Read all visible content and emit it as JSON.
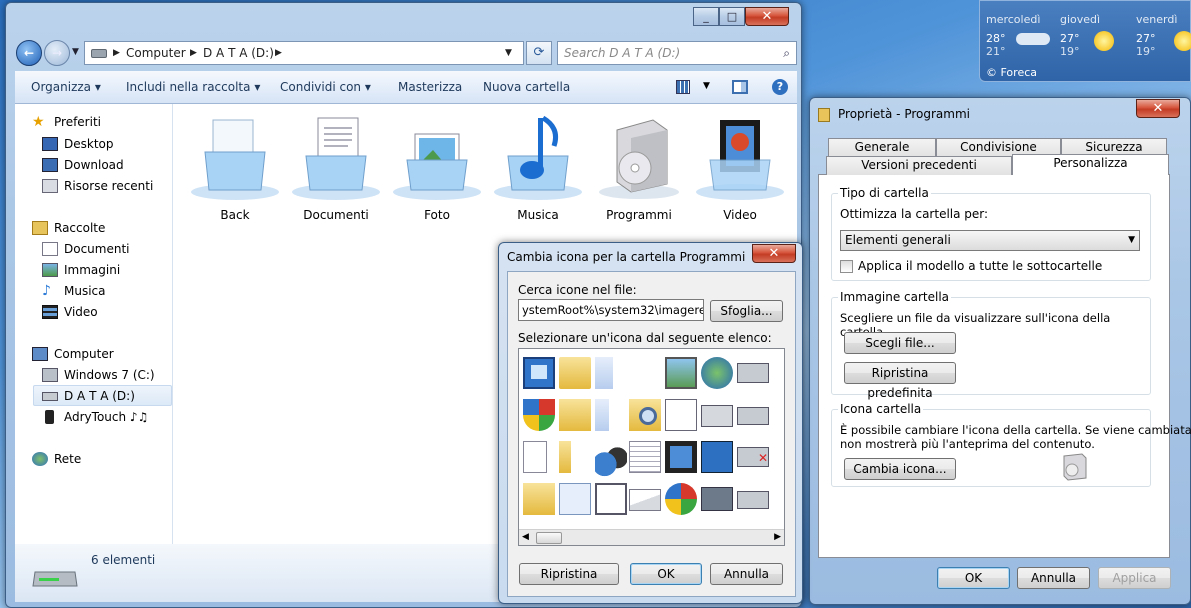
{
  "weather": {
    "days": [
      {
        "name": "mercoledì",
        "hi": "28°",
        "lo": "21°"
      },
      {
        "name": "giovedì",
        "hi": "27°",
        "lo": "19°"
      },
      {
        "name": "venerdì",
        "hi": "27°",
        "lo": "19°"
      }
    ],
    "provider": "© Foreca"
  },
  "explorer": {
    "breadcrumb": [
      "Computer",
      "D A T A (D:)"
    ],
    "search_placeholder": "Search D A T A (D:)",
    "toolbar": {
      "organize": "Organizza",
      "include": "Includi nella raccolta",
      "share": "Condividi con",
      "burn": "Masterizza",
      "new_folder": "Nuova cartella"
    },
    "nav": {
      "favorites": "Preferiti",
      "desktop": "Desktop",
      "downloads": "Download",
      "recent": "Risorse recenti",
      "libraries": "Raccolte",
      "documents": "Documenti",
      "pictures": "Immagini",
      "music": "Musica",
      "videos": "Video",
      "computer": "Computer",
      "drive_c": "Windows 7 (C:)",
      "drive_d": "D A T A (D:)",
      "device": "AdryTouch ♪♫",
      "network": "Rete"
    },
    "folders": [
      "Back",
      "Documenti",
      "Foto",
      "Musica",
      "Programmi",
      "Video"
    ],
    "status": "6 elementi"
  },
  "properties": {
    "title": "Proprietà - Programmi",
    "tabs_row1": [
      "Generale",
      "Condivisione",
      "Sicurezza"
    ],
    "tabs_row2": [
      "Versioni precedenti",
      "Personalizza"
    ],
    "folder_type": {
      "title": "Tipo di cartella",
      "optimize_label": "Ottimizza la cartella per:",
      "selected": "Elementi generali",
      "apply_sub": "Applica il modello a tutte le sottocartelle"
    },
    "folder_image": {
      "title": "Immagine cartella",
      "desc": "Scegliere un file da visualizzare sull'icona della cartella.",
      "choose": "Scegli file...",
      "restore": "Ripristina predefinita"
    },
    "folder_icon": {
      "title": "Icona cartella",
      "desc1": "È possibile cambiare l'icona della cartella. Se viene cambiata,",
      "desc2": "non mostrerà più l'anteprima del contenuto.",
      "change": "Cambia icona..."
    },
    "ok": "OK",
    "cancel": "Annulla",
    "apply": "Applica"
  },
  "dialog": {
    "title": "Cambia icona per la cartella Programmi",
    "search_label": "Cerca icone nel file:",
    "path": "ystemRoot%\\system32\\imageres.dll",
    "browse": "Sfoglia...",
    "list_label": "Selezionare un'icona dal seguente elenco:",
    "restore": "Ripristina",
    "ok": "OK",
    "cancel": "Annulla"
  },
  "colors": {
    "accent": "#3c7fb1",
    "close": "#c43c24",
    "glass": "#a9c6e6"
  }
}
